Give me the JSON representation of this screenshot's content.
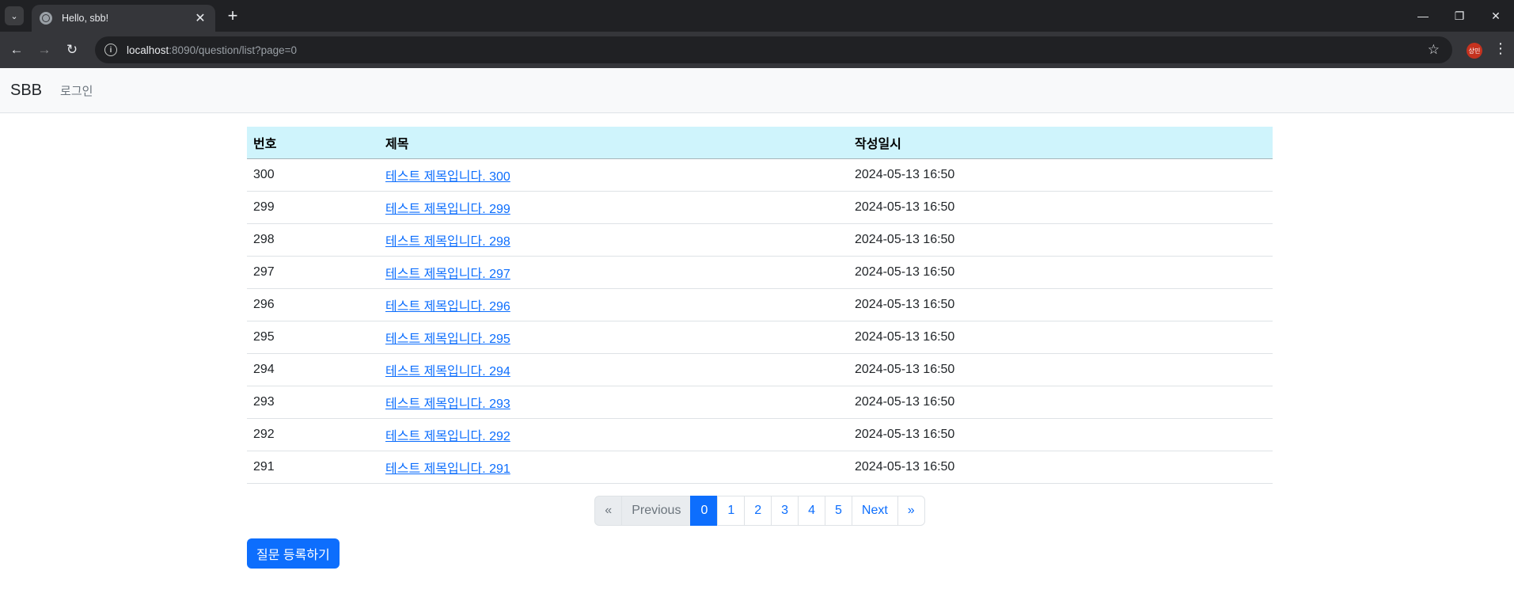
{
  "browser": {
    "tab_title": "Hello, sbb!",
    "url_host": "localhost",
    "url_path": ":8090/question/list?page=0",
    "profile_initials": "상민"
  },
  "navbar": {
    "brand": "SBB",
    "login_link": "로그인"
  },
  "table": {
    "headers": [
      "번호",
      "제목",
      "작성일시"
    ],
    "rows": [
      {
        "num": "300",
        "subject": "테스트 제목입니다. 300",
        "date": "2024-05-13 16:50"
      },
      {
        "num": "299",
        "subject": "테스트 제목입니다. 299",
        "date": "2024-05-13 16:50"
      },
      {
        "num": "298",
        "subject": "테스트 제목입니다. 298",
        "date": "2024-05-13 16:50"
      },
      {
        "num": "297",
        "subject": "테스트 제목입니다. 297",
        "date": "2024-05-13 16:50"
      },
      {
        "num": "296",
        "subject": "테스트 제목입니다. 296",
        "date": "2024-05-13 16:50"
      },
      {
        "num": "295",
        "subject": "테스트 제목입니다. 295",
        "date": "2024-05-13 16:50"
      },
      {
        "num": "294",
        "subject": "테스트 제목입니다. 294",
        "date": "2024-05-13 16:50"
      },
      {
        "num": "293",
        "subject": "테스트 제목입니다. 293",
        "date": "2024-05-13 16:50"
      },
      {
        "num": "292",
        "subject": "테스트 제목입니다. 292",
        "date": "2024-05-13 16:50"
      },
      {
        "num": "291",
        "subject": "테스트 제목입니다. 291",
        "date": "2024-05-13 16:50"
      }
    ]
  },
  "pagination": {
    "items": [
      {
        "label": "«",
        "state": "disabled"
      },
      {
        "label": "Previous",
        "state": "disabled"
      },
      {
        "label": "0",
        "state": "active"
      },
      {
        "label": "1",
        "state": "normal"
      },
      {
        "label": "2",
        "state": "normal"
      },
      {
        "label": "3",
        "state": "normal"
      },
      {
        "label": "4",
        "state": "normal"
      },
      {
        "label": "5",
        "state": "normal"
      },
      {
        "label": "Next",
        "state": "normal"
      },
      {
        "label": "»",
        "state": "normal"
      }
    ]
  },
  "actions": {
    "create_question": "질문 등록하기"
  },
  "colors": {
    "primary": "#0d6efd",
    "table_header": "#cff4fc",
    "navbar_bg": "#f8f9fa"
  }
}
